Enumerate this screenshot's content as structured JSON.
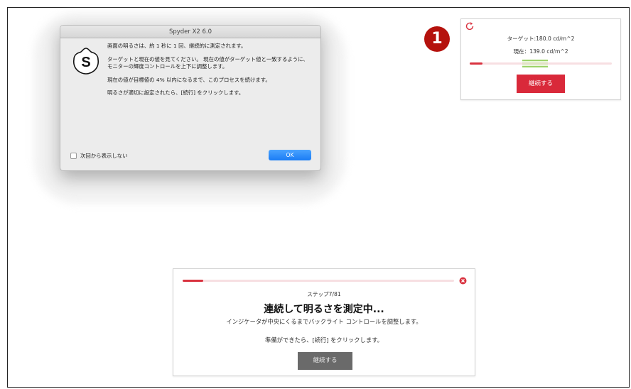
{
  "dialog": {
    "title": "Spyder X2 6.0",
    "logo_letter": "S",
    "paragraph1": "画面の明るさは、約 1 秒に 1 回、継続的に測定されます。",
    "paragraph2": "ターゲットと現在の値を見てください。 現在の値がターゲット値と一致するように、モニターの輝度コントロールを上下に調整します。",
    "paragraph3": "現在の値が目標値の 4% 以内になるまで、このプロセスを続けます。",
    "paragraph4": "明るさが適切に設定されたら、[続行] をクリックします。",
    "checkbox_label": "次回から表示しない",
    "ok_label": "OK"
  },
  "step_badge": "1",
  "measure_panel": {
    "target_text": "ターゲット:180.0 cd/m^2",
    "current_text": "現在：139.0 cd/m^2",
    "current_fraction": 0.09,
    "target_zone_fraction": 0.37,
    "continue_label": "継続する",
    "accent_color": "#d9293a"
  },
  "progress_panel": {
    "progress_fraction": 0.075,
    "step_text": "ステップ7/81",
    "heading": "連続して明るさを測定中...",
    "description": "インジケータが中央にくるまでバックライト コントロールを調整します。",
    "instruction": "準備ができたら、[続行] をクリックします。",
    "continue_label": "継続する"
  },
  "icons": {
    "refresh": "refresh-icon",
    "close": "close-circle-icon",
    "logo": "spyder-logo-icon"
  }
}
